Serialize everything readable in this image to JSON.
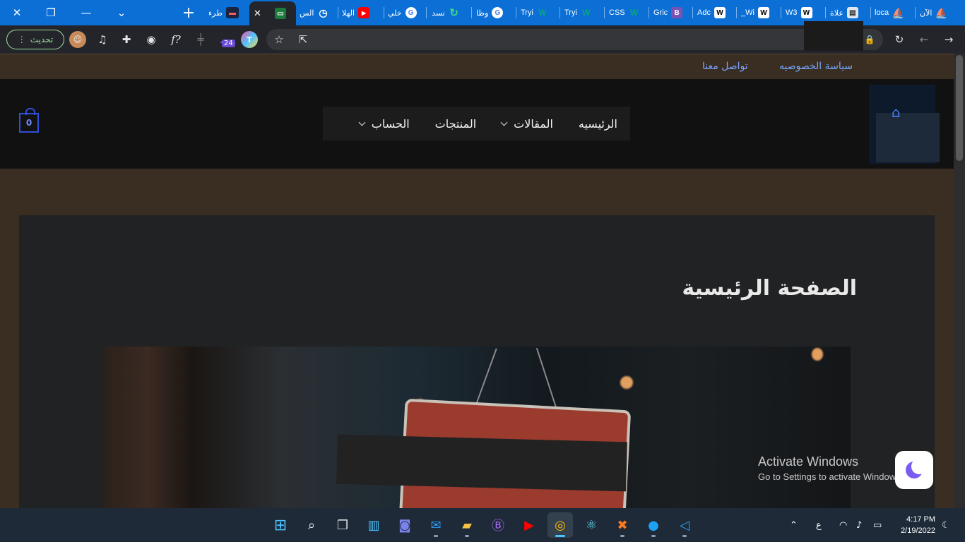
{
  "browser": {
    "tabs": [
      {
        "label": "الآن",
        "icon": "ship-icon"
      },
      {
        "label": "loca",
        "icon": "ship-icon"
      },
      {
        "label": "علاة",
        "icon": "image-icon"
      },
      {
        "label": "W3",
        "icon": "w-icon"
      },
      {
        "label": "_Wi",
        "icon": "w-icon"
      },
      {
        "label": "Adc",
        "icon": "w-icon"
      },
      {
        "label": "Gric",
        "icon": "bootstrap-icon"
      },
      {
        "label": "CSS",
        "icon": "w-green-icon"
      },
      {
        "label": "Tryi",
        "icon": "w-green-icon"
      },
      {
        "label": "Tryi",
        "icon": "w-green-icon"
      },
      {
        "label": "وظا",
        "icon": "google-icon"
      },
      {
        "label": "نسد",
        "icon": "refresh-green-icon"
      },
      {
        "label": "خلي",
        "icon": "google-icon"
      },
      {
        "label": "الهلا",
        "icon": "youtube-icon"
      },
      {
        "label": "الس",
        "icon": "history-icon"
      },
      {
        "label": "",
        "icon": "flag-icon",
        "active": true
      },
      {
        "label": "طرء",
        "icon": "site-icon"
      }
    ],
    "update_label": "تحديث",
    "extension_badge": "24"
  },
  "site": {
    "top_links": [
      "سياسة الخصوصيه",
      "تواصل معنا"
    ],
    "nav": [
      "الرئيسيه",
      "المقالات",
      "المنتجات",
      "الحساب"
    ],
    "cart_count": "0",
    "page_title": "الصفحة الرئيسية"
  },
  "windows": {
    "activate_title": "Activate Windows",
    "activate_sub": "Go to Settings to activate Windows.",
    "time": "4:17 PM",
    "date": "2/19/2022",
    "lang": "ع"
  },
  "colors": {
    "tabstrip": "#0b6fd6",
    "header": "#111111",
    "link": "#78a7ff",
    "cart": "#2f4fd6"
  }
}
